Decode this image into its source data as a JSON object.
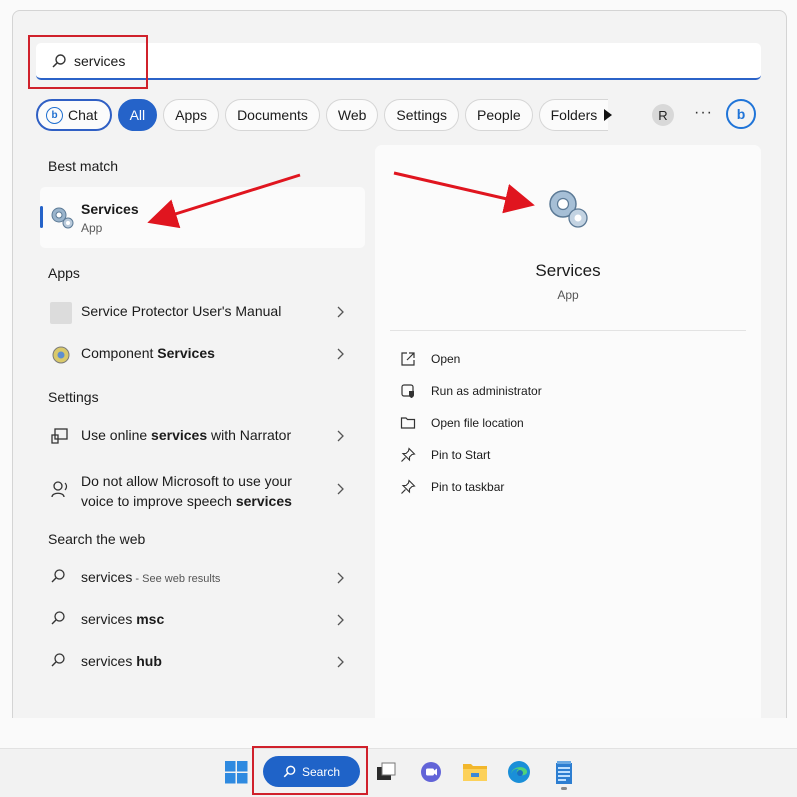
{
  "search": {
    "query": "services"
  },
  "filters": {
    "chips": [
      "Chat",
      "All",
      "Apps",
      "Documents",
      "Web",
      "Settings",
      "People",
      "Folders"
    ],
    "active": "All",
    "avatar_initial": "R",
    "more": "···"
  },
  "sections": {
    "best_match": "Best match",
    "apps": "Apps",
    "settings": "Settings",
    "web": "Search the web"
  },
  "best_match": {
    "title": "Services",
    "subtitle": "App"
  },
  "apps": [
    {
      "label": "Service Protector User's Manual"
    },
    {
      "pre": "Component ",
      "bold": "Services"
    }
  ],
  "settings": [
    {
      "pre": "Use online ",
      "bold": "services",
      "post": " with Narrator"
    },
    {
      "line1": "Do not allow Microsoft to use your",
      "line2_pre": "voice to improve speech ",
      "line2_bold": "services"
    }
  ],
  "web": [
    {
      "pre": "services",
      "suffix": " - See web results"
    },
    {
      "pre": "services ",
      "bold": "msc"
    },
    {
      "pre": "services ",
      "bold": "hub"
    }
  ],
  "detail": {
    "title": "Services",
    "subtitle": "App",
    "actions": [
      "Open",
      "Run as administrator",
      "Open file location",
      "Pin to Start",
      "Pin to taskbar"
    ]
  },
  "taskbar": {
    "search_label": "Search"
  },
  "colors": {
    "accent": "#2563c9",
    "annotation_red": "#d0212b",
    "bing_blue": "#1f74d8"
  }
}
